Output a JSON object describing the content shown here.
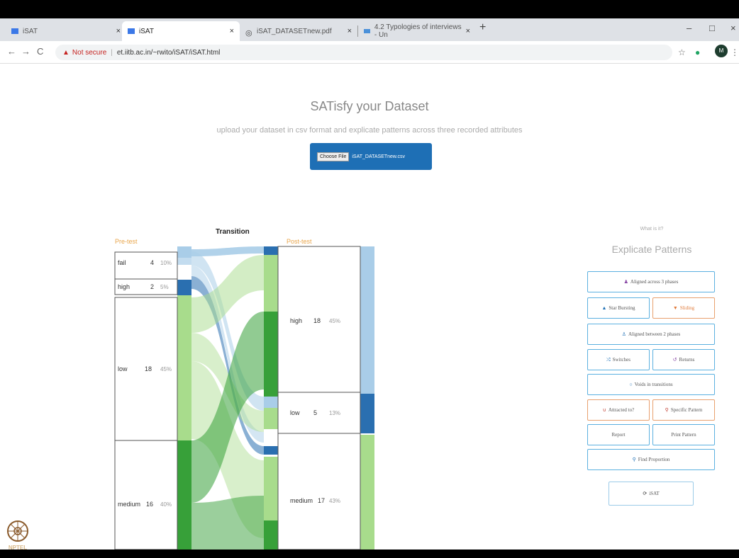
{
  "browser": {
    "tabs": [
      {
        "label": "iSAT",
        "close": "×"
      },
      {
        "label": "iSAT",
        "close": "×"
      },
      {
        "label": "iSAT_DATASETnew.pdf",
        "close": "×"
      },
      {
        "label": "4.2 Typologies of interviews - Un",
        "close": "×"
      }
    ],
    "new_tab": "+",
    "window_controls": [
      "–",
      "□",
      "×"
    ],
    "nav": {
      "back": "←",
      "forward": "→",
      "reload": "C"
    },
    "security_label": "Not secure",
    "url": "et.iitb.ac.in/~rwito/iSAT/iSAT.html",
    "avatar_initial": "M"
  },
  "page": {
    "title": "SATisfy your Dataset",
    "subtitle": "upload your dataset in csv format and explicate patterns across three recorded attributes",
    "choose_file_label": "Choose File",
    "file_name": "iSAT_DATASETnew.csv"
  },
  "diagram": {
    "transition_label": "Transition",
    "pre_label": "Pre-test",
    "post_label": "Post-test",
    "pre": [
      {
        "name": "fail",
        "count": "4",
        "pct": "10%"
      },
      {
        "name": "high",
        "count": "2",
        "pct": "5%"
      },
      {
        "name": "low",
        "count": "18",
        "pct": "45%"
      },
      {
        "name": "medium",
        "count": "16",
        "pct": "40%"
      }
    ],
    "post": [
      {
        "name": "high",
        "count": "18",
        "pct": "45%"
      },
      {
        "name": "low",
        "count": "5",
        "pct": "13%"
      },
      {
        "name": "medium",
        "count": "17",
        "pct": "43%"
      }
    ],
    "colors": {
      "light_blue": "#a9cde8",
      "dark_blue": "#2a6fb0",
      "light_green": "#a8dc8c",
      "dark_green": "#37a039"
    }
  },
  "panel": {
    "what_is_it": "What is it?",
    "heading": "Explicate Patterns",
    "aligned_3": "Aligned across 3 phases",
    "star_bursting": "Star Bursting",
    "sliding": "Sliding",
    "aligned_2": "Aligned between 2 phases",
    "switches": "Switches",
    "returns": "Returns",
    "voids": "Voids in transitions",
    "attracted": "Attracted to?",
    "specific": "Specific Pattern",
    "report": "Report",
    "print": "Print Pattern",
    "find_prop": "Find Proportion",
    "isat": "iSAT"
  },
  "branding": {
    "logo_text": "NPTEL"
  }
}
